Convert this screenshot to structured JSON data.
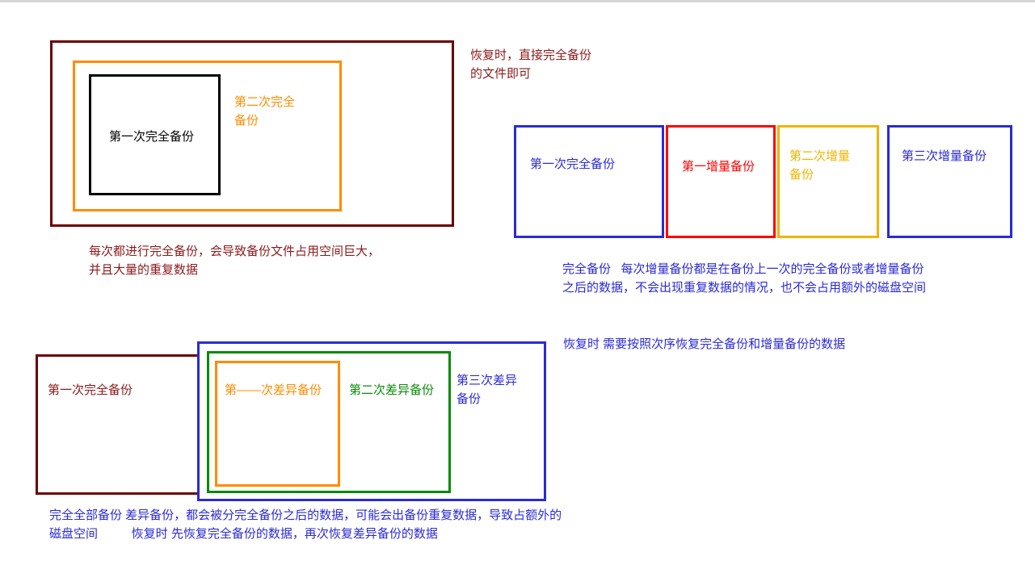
{
  "full": {
    "outer_label": "",
    "box1_label": "第一次完全备份",
    "box2_label": "第二次完全\n备份",
    "note_top": "恢复时，直接完全备份\n的文件即可",
    "note_bottom": "每次都进行完全备份，会导致备份文件占用空间巨大，\n并且大量的重复数据"
  },
  "incremental": {
    "box1_label": "第一次完全备份",
    "box2_label": "第一增量备份",
    "box3_label": "第二次增量\n备份",
    "box4_label": "第三次增量备份",
    "note_bottom": "完全备份   每次增量备份都是在备份上一次的完全备份或者增量备份\n之后的数据，不会出现重复数据的情况，也不会占用额外的磁盘空间",
    "note_recover": "恢复时 需要按照次序恢复完全备份和增量备份的数据"
  },
  "differential": {
    "box1_label": "第一次完全备份",
    "diff1_label": "第——次差异备份",
    "diff2_label": "第二次差异备份",
    "diff3_label": "第三次差异\n备份",
    "note_bottom": "完全全部备份 差异备份，都会被分完全备份之后的数据，可能会出备份重复数据，导致占额外的\n磁盘空间          恢复时 先恢复完全备份的数据，再次恢复差异备份的数据"
  }
}
